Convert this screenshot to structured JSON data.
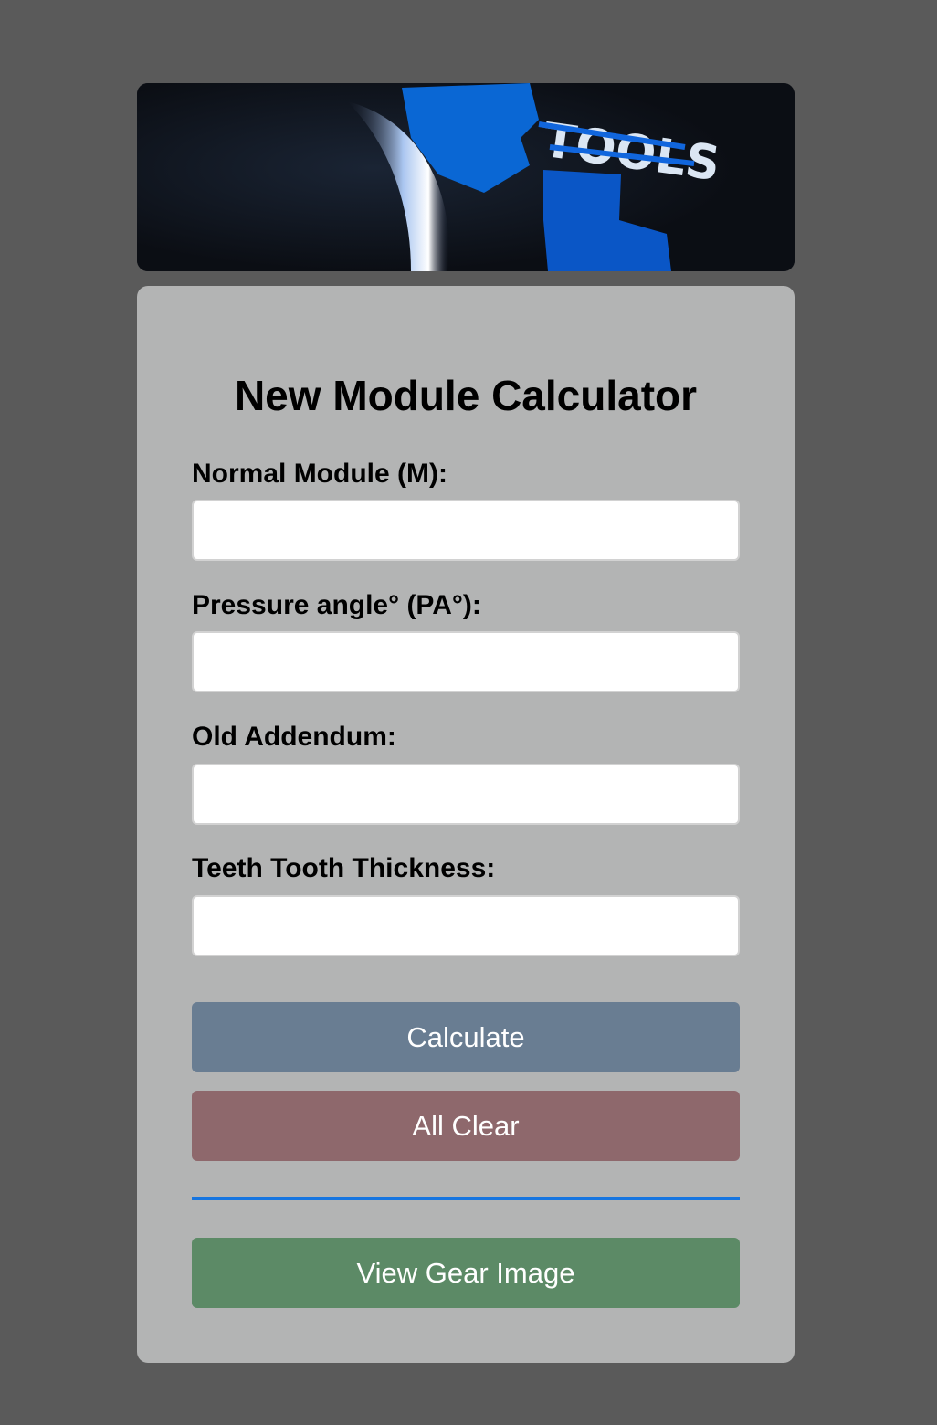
{
  "banner": {
    "text": "TOOLS",
    "alt": "tools banner"
  },
  "calculator": {
    "title": "New Module Calculator",
    "fields": [
      {
        "label": "Normal Module (M):",
        "value": "",
        "placeholder": ""
      },
      {
        "label": "Pressure angle° (PA°):",
        "value": "",
        "placeholder": ""
      },
      {
        "label": "Old Addendum:",
        "value": "",
        "placeholder": ""
      },
      {
        "label": "Teeth Tooth Thickness:",
        "value": "",
        "placeholder": ""
      }
    ],
    "buttons": {
      "calculate": "Calculate",
      "clear": "All Clear",
      "view_gear": "View Gear Image"
    }
  },
  "colors": {
    "page_background": "#5a5a5a",
    "card_background": "#b3b4b4",
    "calculate_button": "#697d92",
    "clear_button": "#8e686c",
    "view_gear_button": "#5c8a66",
    "divider": "#1675e0"
  }
}
